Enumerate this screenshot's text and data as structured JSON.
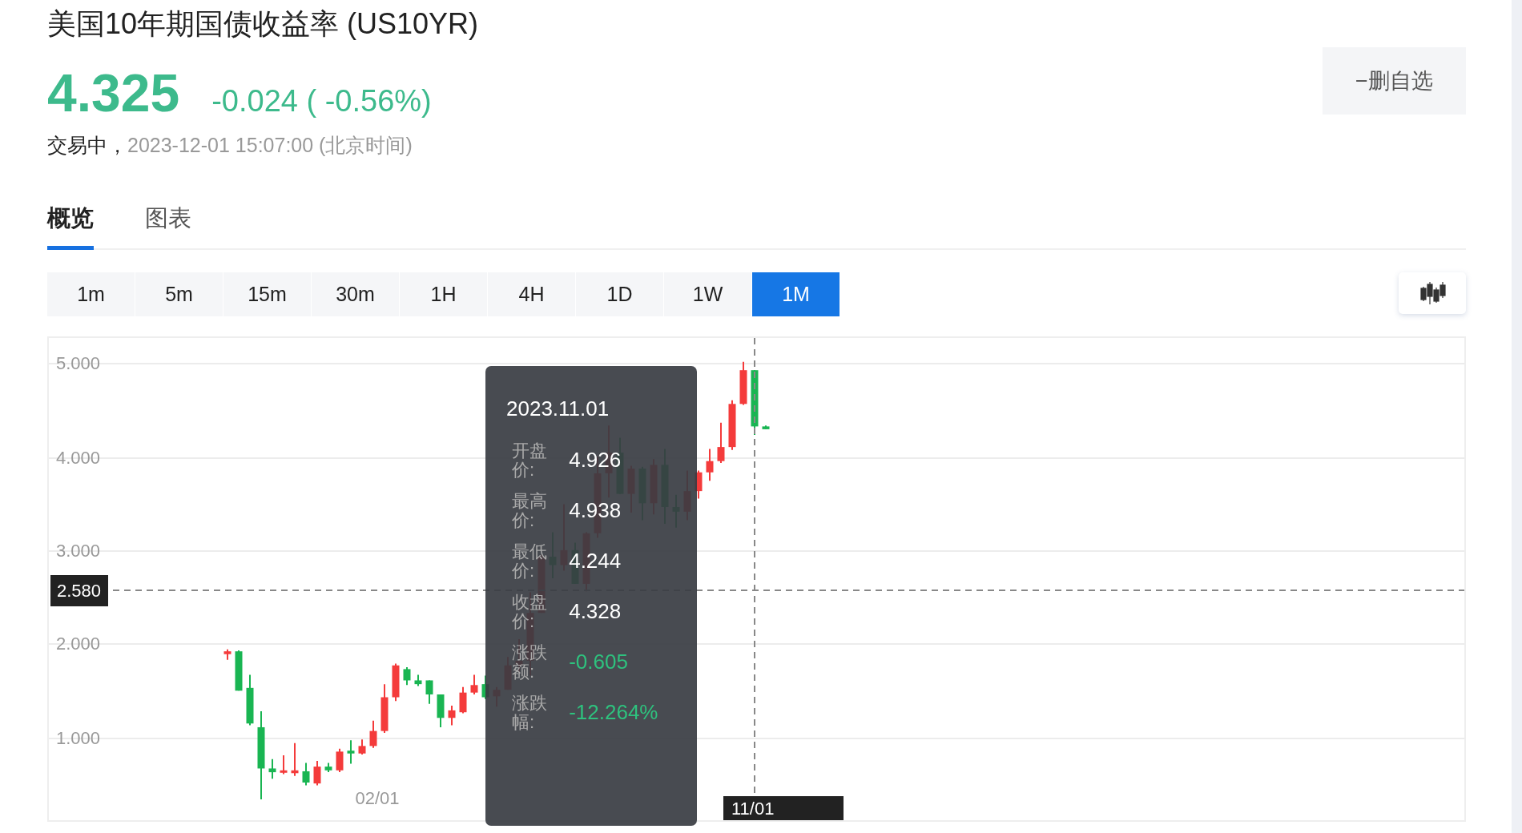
{
  "header": {
    "title": "美国10年期国债收益率 (US10YR)",
    "price": "4.325",
    "change": "-0.024 ( -0.56%)",
    "down": true,
    "status": "交易中，",
    "timestamp": "2023-12-01 15:07:00 (北京时间)"
  },
  "watchlist_button": {
    "label": "−删自选"
  },
  "tabs": [
    {
      "label": "概览",
      "selected": true
    },
    {
      "label": "图表",
      "selected": false
    }
  ],
  "intervals": [
    {
      "label": "1m",
      "selected": false
    },
    {
      "label": "5m",
      "selected": false
    },
    {
      "label": "15m",
      "selected": false
    },
    {
      "label": "30m",
      "selected": false
    },
    {
      "label": "1H",
      "selected": false
    },
    {
      "label": "4H",
      "selected": false
    },
    {
      "label": "1D",
      "selected": false
    },
    {
      "label": "1W",
      "selected": false
    },
    {
      "label": "1M",
      "selected": true
    }
  ],
  "chart": {
    "y_ticks": [
      "5.000",
      "4.000",
      "3.000",
      "2.000",
      "1.000"
    ],
    "x_labels": [
      "02/01"
    ],
    "crosshair": {
      "price": "2.580",
      "date": "11/01"
    },
    "tooltip": {
      "date": "2023.11.01",
      "rows": [
        {
          "label": "开盘价:",
          "value": "4.926",
          "color": "#ffffff"
        },
        {
          "label": "最高价:",
          "value": "4.938",
          "color": "#ffffff"
        },
        {
          "label": "最低价:",
          "value": "4.244",
          "color": "#ffffff"
        },
        {
          "label": "收盘价:",
          "value": "4.328",
          "color": "#ffffff"
        },
        {
          "label": "涨跌额:",
          "value": "-0.605",
          "color": "#2ec27e"
        },
        {
          "label": "涨跌幅:",
          "value": "-12.264%",
          "color": "#2ec27e"
        }
      ]
    }
  }
}
